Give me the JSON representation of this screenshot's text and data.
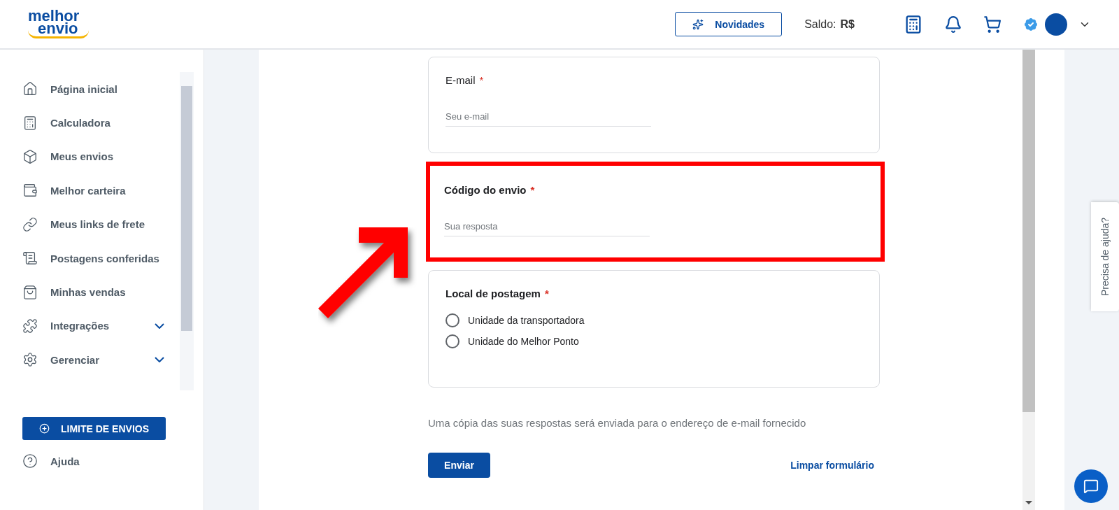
{
  "logo": {
    "line1": "melhor",
    "line2": "envio"
  },
  "header": {
    "news_button": "Novidades",
    "balance_label": "Saldo:",
    "balance_value": "R$"
  },
  "sidebar": {
    "items": [
      {
        "label": "Página inicial",
        "expandable": false
      },
      {
        "label": "Calculadora",
        "expandable": false
      },
      {
        "label": "Meus envios",
        "expandable": false
      },
      {
        "label": "Melhor carteira",
        "expandable": false
      },
      {
        "label": "Meus links de frete",
        "expandable": false
      },
      {
        "label": "Postagens conferidas",
        "expandable": false
      },
      {
        "label": "Minhas vendas",
        "expandable": false
      },
      {
        "label": "Integrações",
        "expandable": true
      },
      {
        "label": "Gerenciar",
        "expandable": true
      }
    ],
    "limit_button": "LIMITE DE ENVIOS",
    "help": "Ajuda"
  },
  "form": {
    "questions": [
      {
        "kind": "text",
        "label": "E-mail",
        "bold": false,
        "required_mark": "*",
        "placeholder": "Seu e-mail",
        "highlighted": false
      },
      {
        "kind": "text",
        "label": "Código do envio",
        "bold": true,
        "required_mark": "*",
        "placeholder": "Sua resposta",
        "highlighted": true
      },
      {
        "kind": "radio",
        "label": "Local de postagem",
        "bold": true,
        "required_mark": "*",
        "highlighted": false,
        "options": [
          {
            "label": "Unidade da transportadora",
            "selected": false
          },
          {
            "label": "Unidade do Melhor Ponto",
            "selected": false
          }
        ]
      }
    ],
    "note": "Uma cópia das suas respostas será enviada para o endereço de e-mail fornecido",
    "submit": "Enviar",
    "clear": "Limpar formulário"
  },
  "help_tab": "Precisa de ajuda?"
}
